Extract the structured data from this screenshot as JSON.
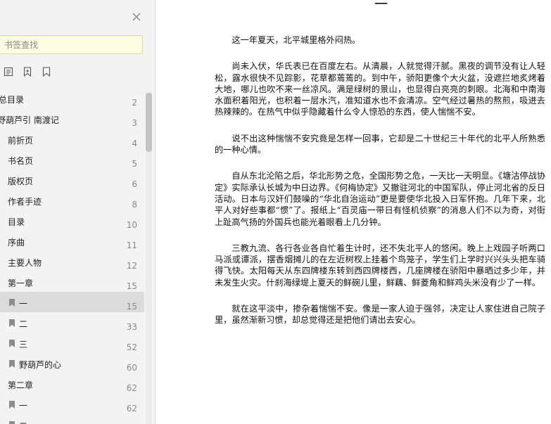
{
  "sidebar": {
    "search_placeholder": "书签查找",
    "toc": [
      {
        "label": "总目录",
        "page": "2",
        "indent": -2,
        "bookmark": false,
        "active": false
      },
      {
        "label": "野葫芦引 南渡记",
        "page": "3",
        "indent": -4,
        "bookmark": false,
        "active": false
      },
      {
        "label": "前折页",
        "page": "4",
        "indent": 11,
        "bookmark": false,
        "active": false
      },
      {
        "label": "书名页",
        "page": "5",
        "indent": 11,
        "bookmark": false,
        "active": false
      },
      {
        "label": "版权页",
        "page": "6",
        "indent": 11,
        "bookmark": false,
        "active": false
      },
      {
        "label": "作者手迹",
        "page": "8",
        "indent": 11,
        "bookmark": false,
        "active": false
      },
      {
        "label": "目录",
        "page": "10",
        "indent": 11,
        "bookmark": false,
        "active": false
      },
      {
        "label": "序曲",
        "page": "11",
        "indent": 11,
        "bookmark": false,
        "active": false
      },
      {
        "label": "主要人物",
        "page": "12",
        "indent": 11,
        "bookmark": false,
        "active": false
      },
      {
        "label": "第一章",
        "page": "15",
        "indent": 11,
        "bookmark": false,
        "active": false
      },
      {
        "label": "一",
        "page": "15",
        "indent": 27,
        "bookmark": true,
        "active": true
      },
      {
        "label": "二",
        "page": "33",
        "indent": 27,
        "bookmark": true,
        "active": false
      },
      {
        "label": "三",
        "page": "52",
        "indent": 27,
        "bookmark": true,
        "active": false
      },
      {
        "label": "野葫芦的心",
        "page": "60",
        "indent": 27,
        "bookmark": true,
        "active": false
      },
      {
        "label": "第二章",
        "page": "62",
        "indent": 11,
        "bookmark": false,
        "active": false
      },
      {
        "label": "一",
        "page": "62",
        "indent": 27,
        "bookmark": true,
        "active": false
      },
      {
        "label": "二",
        "page": "",
        "indent": 27,
        "bookmark": true,
        "active": false
      }
    ]
  },
  "document": {
    "chapter_heading": "一",
    "paragraphs": [
      "这一年夏天，北平城里格外闷热。",
      "尚未入伏，华氏表已在百度左右。从清晨，人就觉得汗腻。黑夜的调节没有让人轻松，露水很快不见踪影，花草都蔫蔫的。到中午，骄阳更像个大火盆，没遮拦地炙烤着大地，哪儿也吹不来一丝凉风。满是绿树的景山，也显得白亮亮的刺眼。北海和中南海水面积着阳光，也积着一层水汽，准知道水也不会清凉。空气经过暑热的熬煎，吸进去热辣辣的。在热气中似乎隐藏着什么令人惊恐的东西，使人惴惴不安。",
      "说不出这种惴惴不安究竟是怎样一回事，它却是二十世纪三十年代的北平人所熟悉的一种心情。",
      "自从东北沦陷之后，华北形势之危，全国形势之危，一天比一天明显。《塘沽停战协定》实际承认长城为中日边界。《何梅协定》又撤驻河北的中国军队，停止河北省的反日活动。日本与汉奸们鼓噪的“华北自治运动”更是要使华北投入日军怀抱。几年下来，北平人对好些事都“惯”了。报纸上“百灵庙一带日有怪机侦察”的消息人们不以为奇，对街上趾高气扬的外国兵也能光着眼看上几分钟。",
      "三教九流、各行各业各自忙着生计时，还不失北平人的悠闲。晚上上戏园子听两口马派或谭派，摆香烟摊儿的在左近树杈上挂着个鸟笼子，学生们上学时兴兴头头把车骑得飞快。太阳每天从东四牌楼东转到西四牌楼西，几座牌楼在骄阳中暴晒过多少年，并未发生火灾。什刹海绿堤上夏天的鲜碗儿里，鲜藕、鲜菱角和鲜鸡头米没有少了一样。",
      "就在这平淡中，掺杂着惴惴不安。像是一家人迫于强邻，决定让人家住进自己院子里，虽然渐新习惯，却总觉得还是把他们请出去安心。"
    ]
  },
  "icons": {
    "close": "close-icon",
    "toolbar": [
      "bookmark-list-icon",
      "add-bookmark-icon",
      "bookmark-icon"
    ]
  },
  "colors": {
    "sidebar_bg": "#f3f3f3",
    "search_bg": "#fcfce1",
    "active_row": "#dcdcdc"
  }
}
